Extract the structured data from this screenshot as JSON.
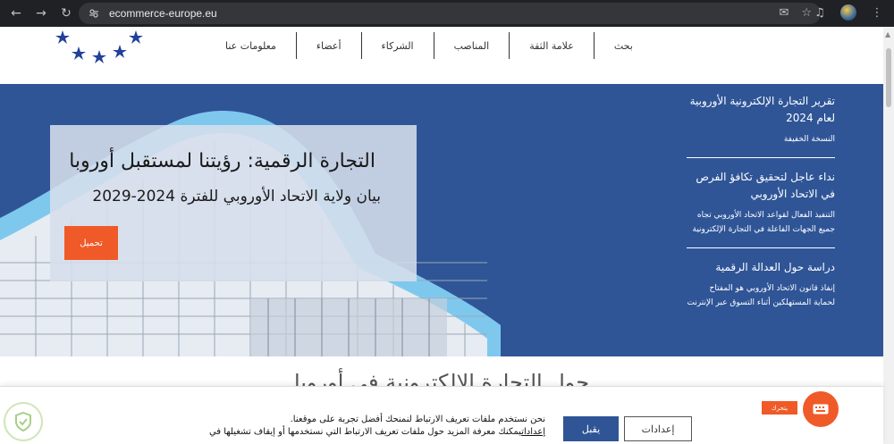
{
  "browser": {
    "url": "ecommerce-europe.eu",
    "back_icon": "back-arrow-icon",
    "forward_icon": "forward-arrow-icon",
    "reload_icon": "reload-icon"
  },
  "header": {
    "nav": [
      {
        "label": "بحث"
      },
      {
        "label": "علامة الثقة"
      },
      {
        "label": "المناصب"
      },
      {
        "label": "الشركاء"
      },
      {
        "label": "أعضاء"
      },
      {
        "label": "معلومات عنا"
      }
    ],
    "logo_colors": {
      "star": "#22409a"
    }
  },
  "hero": {
    "title": "التجارة الرقمية: رؤيتنا لمستقبل أوروبا",
    "subtitle": "بيان ولاية الاتحاد الأوروبي للفترة 2024-2029",
    "download_label": "تحميل",
    "side_items": [
      {
        "title": "تقرير التجارة الإلكترونية الأوروبية لعام 2024",
        "desc": "النسخة الخفيفة"
      },
      {
        "title": "نداء عاجل لتحقيق تكافؤ الفرص في الاتحاد الأوروبي",
        "desc": "التنفيذ الفعال لقواعد الاتحاد الأوروبي تجاه جميع الجهات الفاعلة في التجارة الإلكترونية"
      },
      {
        "title": "دراسة حول العدالة الرقمية",
        "desc": "إنفاذ قانون الاتحاد الأوروبي هو المفتاح لحماية المستهلكين أثناء التسوق عبر الإنترنت"
      }
    ]
  },
  "section": {
    "heading": "حول التجارة الإلكترونية في أوروبا"
  },
  "cookie": {
    "line1": "نحن نستخدم ملفات تعريف الارتباط لنمنحك أفضل تجربة على موقعنا.",
    "link": "إعدادات",
    "line2": "يمكنك معرفة المزيد حول ملفات تعريف الارتباط التي نستخدمها أو إيقاف تشغيلها في",
    "accept_label": "يقبل",
    "settings_label": "إعدادات"
  },
  "floating": {
    "tag": "يتحرك",
    "icon": "chat-keyboard-icon"
  },
  "colors": {
    "hero_bg": "#2f5597",
    "accent": "#f05a28"
  }
}
